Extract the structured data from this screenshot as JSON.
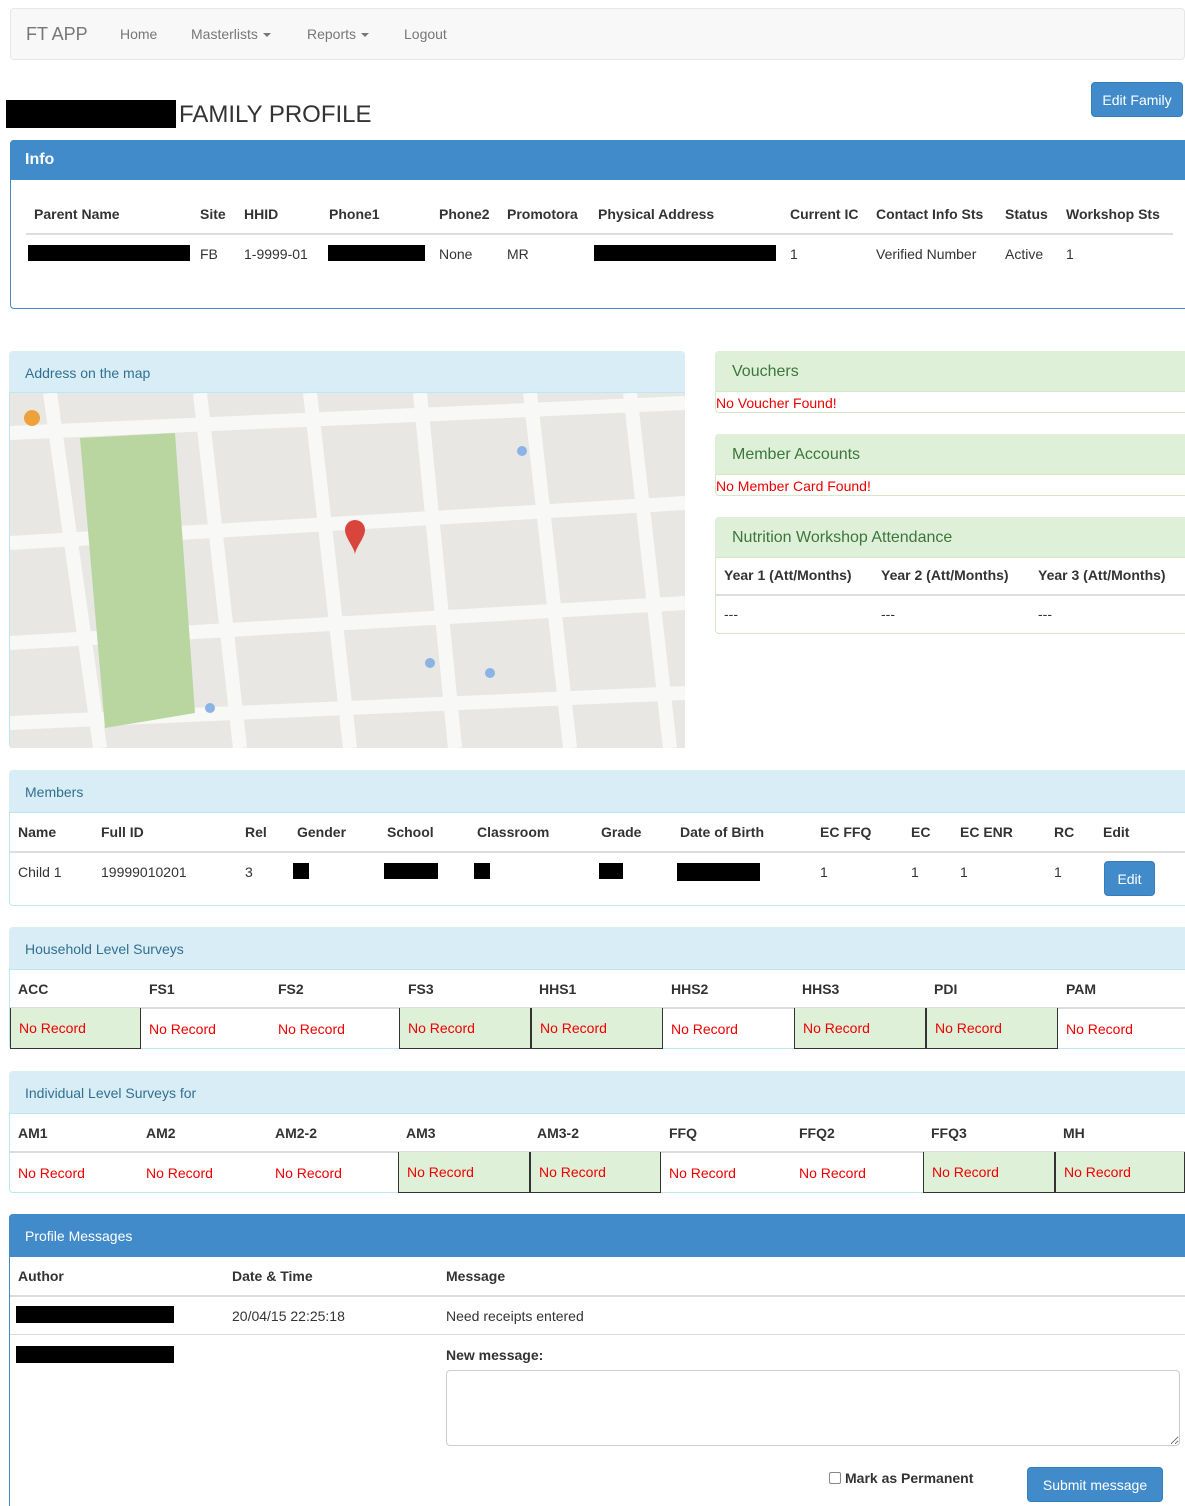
{
  "nav": {
    "brand": "FT APP",
    "home": "Home",
    "masterlists": "Masterlists",
    "reports": "Reports",
    "logout": "Logout"
  },
  "page": {
    "title": "FAMILY PROFILE",
    "edit_family": "Edit Family"
  },
  "info": {
    "heading": "Info",
    "headers": [
      "Parent Name",
      "Site",
      "HHID",
      "Phone1",
      "Phone2",
      "Promotora",
      "Physical Address",
      "Current IC",
      "Contact Info Sts",
      "Status",
      "Workshop Sts"
    ],
    "row": {
      "site": "FB",
      "hhid": "1-9999-01",
      "phone2": "None",
      "promotora": "MR",
      "current_ic": "1",
      "contact_info_sts": "Verified Number",
      "status": "Active",
      "workshop_sts": "1"
    }
  },
  "map": {
    "heading": "Address on the map"
  },
  "vouchers": {
    "heading": "Vouchers",
    "empty": "No Voucher Found!"
  },
  "member_accounts": {
    "heading": "Member Accounts",
    "empty": "No Member Card Found!"
  },
  "workshop": {
    "heading": "Nutrition Workshop Attendance",
    "headers": [
      "Year 1 (Att/Months)",
      "Year 2 (Att/Months)",
      "Year 3 (Att/Months)"
    ],
    "values": [
      "---",
      "---",
      "---"
    ]
  },
  "members": {
    "heading": "Members",
    "headers": [
      "Name",
      "Full ID",
      "Rel",
      "Gender",
      "School",
      "Classroom",
      "Grade",
      "Date of Birth",
      "EC FFQ",
      "EC",
      "EC ENR",
      "RC",
      "Edit"
    ],
    "row": {
      "name": "Child 1",
      "full_id": "19999010201",
      "rel": "3",
      "ec_ffq": "1",
      "ec": "1",
      "ec_enr": "1",
      "rc": "1",
      "edit": "Edit"
    }
  },
  "household": {
    "heading": "Household Level Surveys",
    "headers": [
      "ACC",
      "FS1",
      "FS2",
      "FS3",
      "HHS1",
      "HHS2",
      "HHS3",
      "PDI",
      "PAM"
    ],
    "values": [
      "No Record",
      "No Record",
      "No Record",
      "No Record",
      "No Record",
      "No Record",
      "No Record",
      "No Record",
      "No Record"
    ]
  },
  "individual": {
    "heading": "Individual Level Surveys for",
    "headers": [
      "AM1",
      "AM2",
      "AM2-2",
      "AM3",
      "AM3-2",
      "FFQ",
      "FFQ2",
      "FFQ3",
      "MH"
    ],
    "values": [
      "No Record",
      "No Record",
      "No Record",
      "No Record",
      "No Record",
      "No Record",
      "No Record",
      "No Record",
      "No Record"
    ]
  },
  "messages": {
    "heading": "Profile Messages",
    "headers": [
      "Author",
      "Date & Time",
      "Message"
    ],
    "row": {
      "datetime": "20/04/15 22:25:18",
      "message": "Need receipts entered"
    },
    "new_label": "New message:",
    "permanent_label": "Mark as Permanent",
    "submit": "Submit message"
  },
  "colors": {
    "primary": "#428bca",
    "info_bg": "#d9edf7",
    "success_bg": "#dff0d8",
    "error": "#e00"
  }
}
